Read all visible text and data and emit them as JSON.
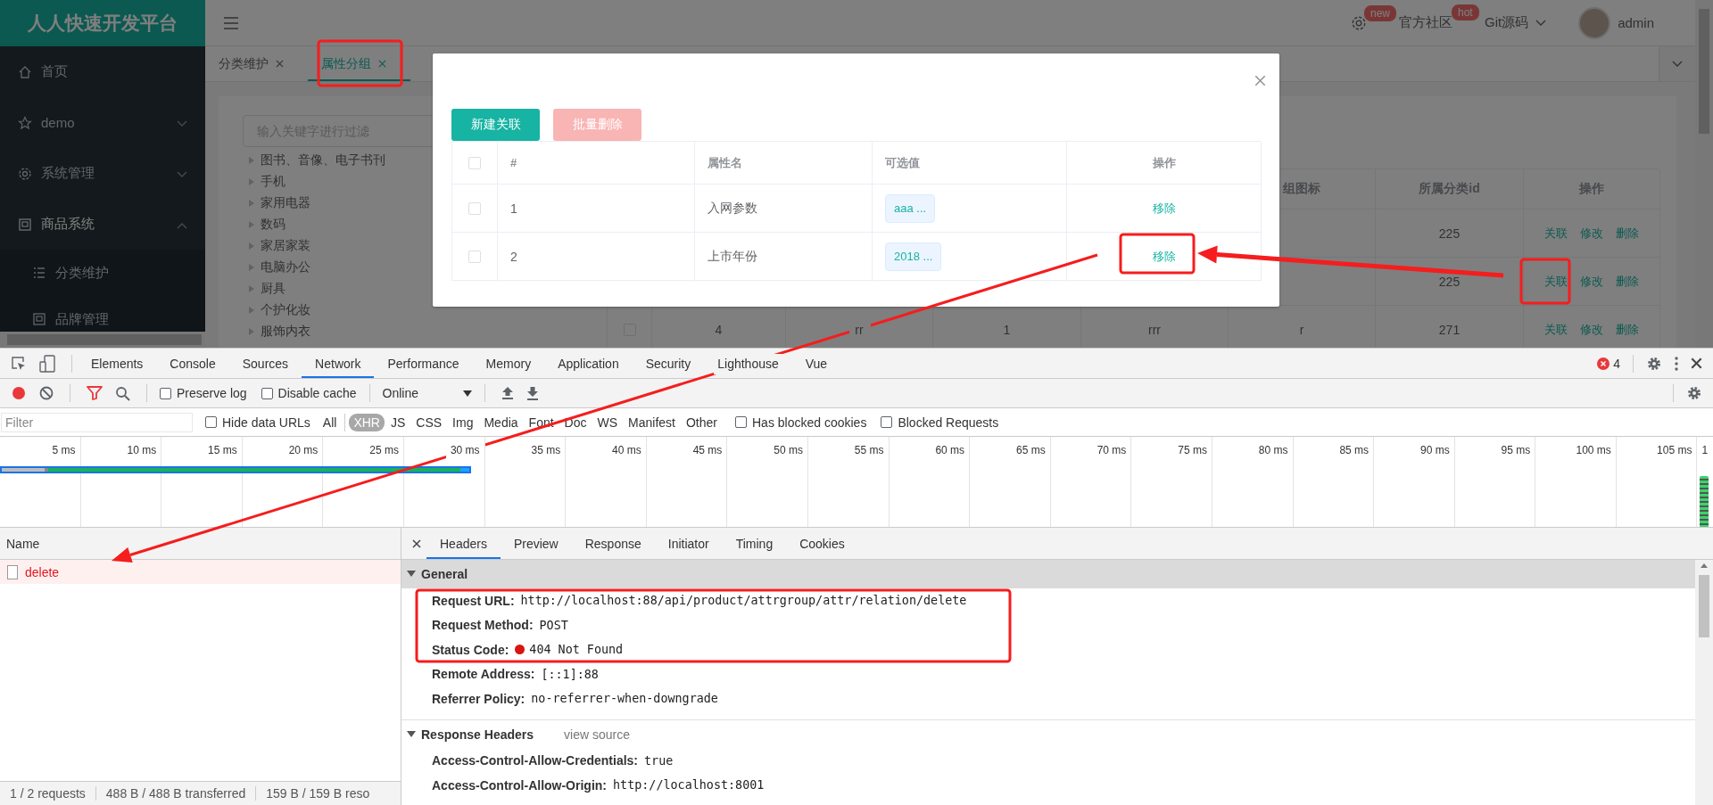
{
  "app": {
    "logo": "人人快速开发平台",
    "header": {
      "settings_badge": "new",
      "links": [
        {
          "label": "官方社区",
          "badge": "hot",
          "dropdown": false
        },
        {
          "label": "Git源码",
          "dropdown": true
        }
      ],
      "user": "admin"
    },
    "sidebar": [
      {
        "kind": "link",
        "label": "首页"
      },
      {
        "kind": "submenu",
        "label": "demo",
        "expanded": false
      },
      {
        "kind": "submenu",
        "label": "系统管理",
        "expanded": false
      },
      {
        "kind": "submenu",
        "label": "商品系统",
        "expanded": true,
        "children": [
          {
            "label": "分类维护"
          },
          {
            "label": "品牌管理"
          }
        ]
      }
    ],
    "tabs": [
      {
        "label": "分类维护",
        "selected": false
      },
      {
        "label": "属性分组",
        "selected": true
      }
    ],
    "tree": {
      "placeholder": "输入关键字进行过滤",
      "items": [
        {
          "label": "图书、音像、电子书刊",
          "expanded": false
        },
        {
          "label": "手机",
          "expanded": false
        },
        {
          "label": "家用电器",
          "expanded": false
        },
        {
          "label": "数码",
          "expanded": false
        },
        {
          "label": "家居家装",
          "expanded": false
        },
        {
          "label": "电脑办公",
          "expanded": false
        },
        {
          "label": "厨具",
          "expanded": false
        },
        {
          "label": "个护化妆",
          "expanded": false
        },
        {
          "label": "服饰内衣",
          "expanded": false
        }
      ]
    },
    "table": {
      "columns": [
        null,
        null,
        null,
        null,
        "组图标",
        "所属分类id"
      ],
      "actions_column": "操作",
      "rows": [
        {
          "cells": [
            null,
            null,
            null,
            null,
            null,
            "225"
          ],
          "actions": [
            "关联",
            "修改",
            "删除"
          ]
        },
        {
          "cells": [
            null,
            null,
            null,
            null,
            null,
            "225"
          ],
          "actions": [
            "关联",
            "修改",
            "删除"
          ]
        },
        {
          "checked": false,
          "cells": [
            "4",
            "rr",
            "1",
            "rrr",
            "r",
            "271"
          ],
          "actions": [
            "关联",
            "修改",
            "删除"
          ]
        }
      ]
    },
    "dialog": {
      "buttons": [
        {
          "label": "新建关联",
          "disabled": false
        },
        {
          "label": "批量删除",
          "disabled": true
        }
      ],
      "all_checked": false,
      "columns": [
        "#",
        "属性名",
        "可选值",
        "操作"
      ],
      "rows": [
        {
          "checked": false,
          "index": "1",
          "name": "入网参数",
          "value": "aaa ...",
          "action": "移除"
        },
        {
          "checked": false,
          "index": "2",
          "name": "上市年份",
          "value": "2018 ...",
          "action": "移除"
        }
      ]
    }
  },
  "devtools": {
    "tabs": [
      {
        "label": "Elements",
        "selected": false
      },
      {
        "label": "Console",
        "selected": false
      },
      {
        "label": "Sources",
        "selected": false
      },
      {
        "label": "Network",
        "selected": true
      },
      {
        "label": "Performance",
        "selected": false
      },
      {
        "label": "Memory",
        "selected": false
      },
      {
        "label": "Application",
        "selected": false
      },
      {
        "label": "Security",
        "selected": false
      },
      {
        "label": "Lighthouse",
        "selected": false
      },
      {
        "label": "Vue",
        "selected": false
      }
    ],
    "error_count": "4",
    "recording": true,
    "toolbar_checks": [
      {
        "label": "Preserve log",
        "checked": false
      },
      {
        "label": "Disable cache",
        "checked": false
      }
    ],
    "throttling": "Online",
    "filter": {
      "placeholder": "Filter",
      "hide_data_urls": {
        "label": "Hide data URLs",
        "checked": false
      },
      "types": [
        {
          "label": "All",
          "selected": false
        },
        {
          "label": "XHR",
          "selected": true
        },
        {
          "label": "JS",
          "selected": false
        },
        {
          "label": "CSS",
          "selected": false
        },
        {
          "label": "Img",
          "selected": false
        },
        {
          "label": "Media",
          "selected": false
        },
        {
          "label": "Font",
          "selected": false
        },
        {
          "label": "Doc",
          "selected": false
        },
        {
          "label": "WS",
          "selected": false
        },
        {
          "label": "Manifest",
          "selected": false
        },
        {
          "label": "Other",
          "selected": false
        }
      ],
      "checks": [
        {
          "label": "Has blocked cookies",
          "checked": false
        },
        {
          "label": "Blocked Requests",
          "checked": false
        }
      ]
    },
    "timeline_ticks": [
      "5 ms",
      "10 ms",
      "15 ms",
      "20 ms",
      "25 ms",
      "30 ms",
      "35 ms",
      "40 ms",
      "45 ms",
      "50 ms",
      "55 ms",
      "60 ms",
      "65 ms",
      "70 ms",
      "75 ms",
      "80 ms",
      "85 ms",
      "90 ms",
      "95 ms",
      "100 ms",
      "105 ms",
      "1"
    ],
    "requests": {
      "column": "Name",
      "rows": [
        {
          "name": "delete",
          "selected": true,
          "failed": true
        }
      ]
    },
    "detail": {
      "tabs": [
        {
          "label": "Headers",
          "selected": true
        },
        {
          "label": "Preview",
          "selected": false
        },
        {
          "label": "Response",
          "selected": false
        },
        {
          "label": "Initiator",
          "selected": false
        },
        {
          "label": "Timing",
          "selected": false
        },
        {
          "label": "Cookies",
          "selected": false
        }
      ],
      "sections": [
        {
          "title": "General",
          "expanded": true,
          "rows": [
            {
              "kind": "plain",
              "key": "Request URL:",
              "value": "http://localhost:88/api/product/attrgroup/attr/relation/delete"
            },
            {
              "kind": "plain",
              "key": "Request Method:",
              "value": "POST"
            },
            {
              "kind": "status",
              "key": "Status Code:",
              "value": "404 Not Found"
            },
            {
              "kind": "plain",
              "key": "Remote Address:",
              "value": "[::1]:88"
            },
            {
              "kind": "plain",
              "key": "Referrer Policy:",
              "value": "no-referrer-when-downgrade"
            }
          ]
        },
        {
          "title": "Response Headers",
          "expanded": true,
          "link": "view source",
          "rows": [
            {
              "kind": "plain",
              "key": "Access-Control-Allow-Credentials:",
              "value": "true"
            },
            {
              "kind": "plain",
              "key": "Access-Control-Allow-Origin:",
              "value": "http://localhost:8001"
            }
          ]
        }
      ]
    },
    "status_bar": [
      "1 / 2 requests",
      "488 B / 488 B transferred",
      "159 B / 159 B reso"
    ]
  }
}
